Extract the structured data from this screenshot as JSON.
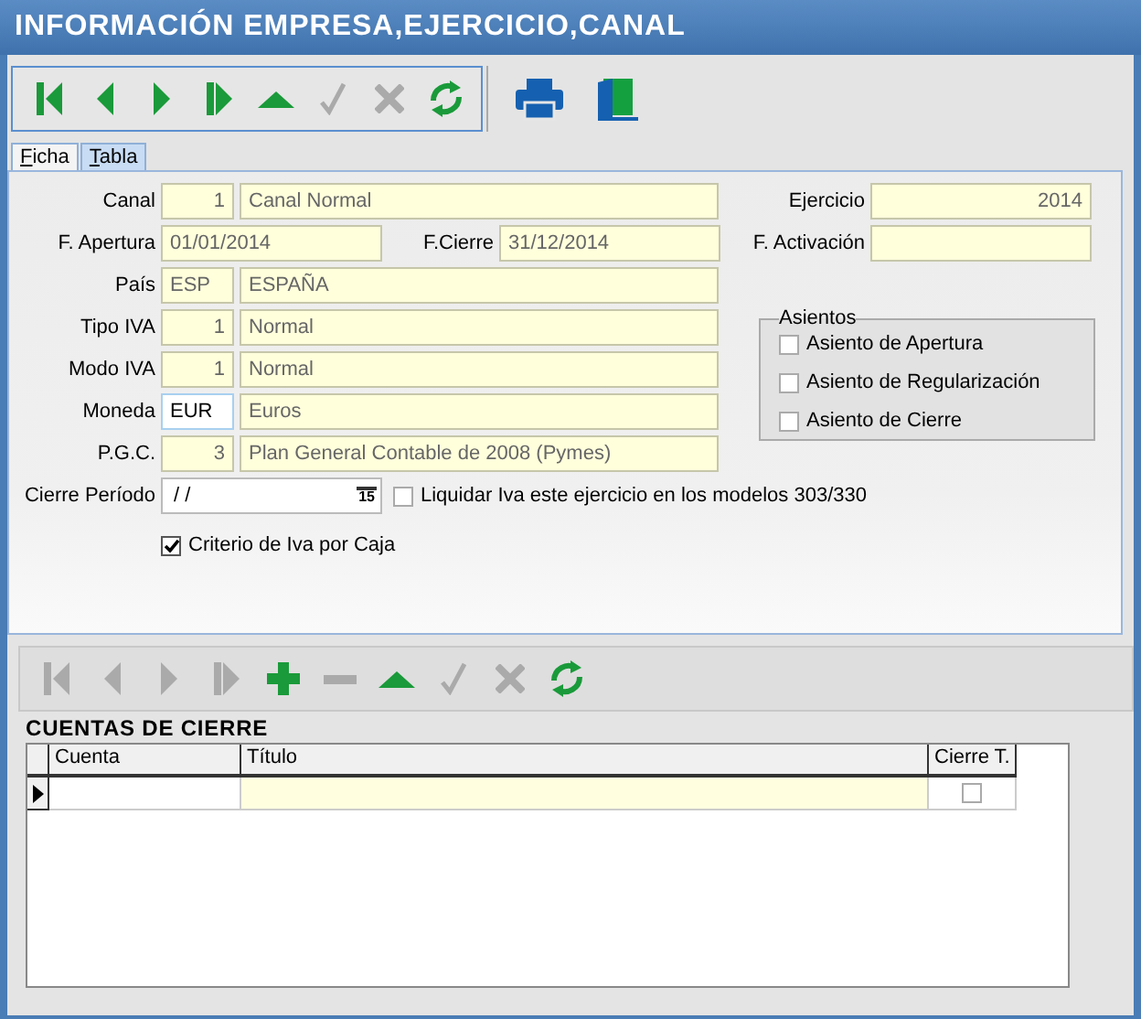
{
  "window": {
    "title": "INFORMACIÓN EMPRESA,EJERCICIO,CANAL"
  },
  "toolbar": {
    "buttons": [
      {
        "kind": "first",
        "disabled": false
      },
      {
        "kind": "prev",
        "disabled": false
      },
      {
        "kind": "next",
        "disabled": false
      },
      {
        "kind": "last",
        "disabled": false
      },
      {
        "kind": "up",
        "disabled": false
      },
      {
        "kind": "check",
        "disabled": true
      },
      {
        "kind": "cancel",
        "disabled": true
      },
      {
        "kind": "refresh",
        "disabled": false
      }
    ],
    "tools": [
      {
        "kind": "print"
      },
      {
        "kind": "exit"
      }
    ]
  },
  "tabs": [
    {
      "label": "Ficha",
      "selected": true
    },
    {
      "label": "Tabla",
      "selected": false
    }
  ],
  "form": {
    "rows": [
      {
        "kind": "lookup",
        "label": "Canal",
        "code": "1",
        "numeric": true,
        "editable": false,
        "description": "Canal Normal"
      },
      {
        "kind": "range",
        "label": "F. Apertura",
        "value": "01/01/2014",
        "label2": "F.Cierre",
        "value2": "31/12/2014"
      },
      {
        "kind": "lookup",
        "label": "País",
        "code": "ESP",
        "numeric": false,
        "editable": false,
        "description": "ESPAÑA"
      },
      {
        "kind": "lookup",
        "label": "Tipo IVA",
        "code": "1",
        "numeric": true,
        "editable": false,
        "description": "Normal"
      },
      {
        "kind": "lookup",
        "label": "Modo IVA",
        "code": "1",
        "numeric": true,
        "editable": false,
        "description": "Normal"
      },
      {
        "kind": "lookup",
        "label": "Moneda",
        "code": "EUR",
        "numeric": false,
        "editable": true,
        "description": "Euros"
      },
      {
        "kind": "lookup",
        "label": "P.G.C.",
        "code": "3",
        "numeric": true,
        "editable": false,
        "description": "Plan General Contable de 2008 (Pymes)"
      },
      {
        "kind": "period",
        "label": "Cierre Período",
        "value": "/ /",
        "calendar": "15"
      }
    ],
    "right": [
      {
        "label": "Ejercicio",
        "value": "2014"
      },
      {
        "label": "F. Activación"
      }
    ],
    "asientos": {
      "title": "Asientos",
      "options": [
        {
          "label": "Asiento de Apertura",
          "checked": false
        },
        {
          "label": "Asiento de Regularización",
          "checked": false
        },
        {
          "label": "Asiento de Cierre",
          "checked": false
        }
      ]
    },
    "liquidar": {
      "label": "Liquidar Iva este ejercicio en los modelos 303/330",
      "checked": false
    },
    "criterio": {
      "label": "Criterio de Iva por Caja",
      "checked": true
    }
  },
  "detail_toolbar": {
    "buttons": [
      {
        "kind": "first",
        "disabled": true
      },
      {
        "kind": "prev",
        "disabled": true
      },
      {
        "kind": "next",
        "disabled": true
      },
      {
        "kind": "last",
        "disabled": true
      },
      {
        "kind": "add",
        "disabled": false
      },
      {
        "kind": "remove",
        "disabled": true
      },
      {
        "kind": "up",
        "disabled": false
      },
      {
        "kind": "check",
        "disabled": true
      },
      {
        "kind": "cancel",
        "disabled": true
      },
      {
        "kind": "refresh",
        "disabled": false
      }
    ]
  },
  "grid": {
    "title": "CUENTAS DE CIERRE",
    "columns": [
      "Cuenta",
      "Título",
      "Cierre T."
    ],
    "rows": [
      {
        "current": true,
        "cierre_t": false
      }
    ]
  }
}
